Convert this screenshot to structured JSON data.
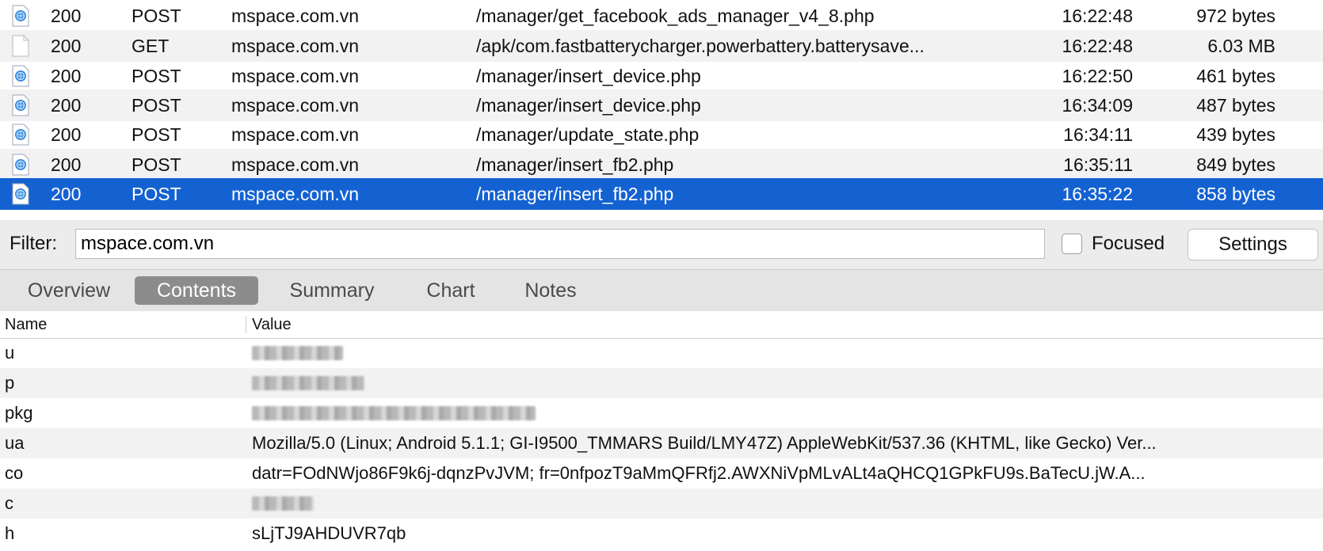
{
  "requests": [
    {
      "icon": "globe-doc-icon",
      "status": "200",
      "method": "POST",
      "host": "mspace.com.vn",
      "path": "/manager/get_facebook_ads_manager_v4_8.php",
      "time": "16:22:48",
      "size": "972 bytes"
    },
    {
      "icon": "blank-doc-icon",
      "status": "200",
      "method": "GET",
      "host": "mspace.com.vn",
      "path": "/apk/com.fastbatterycharger.powerbattery.batterysave...",
      "time": "16:22:48",
      "size": "6.03 MB"
    },
    {
      "icon": "globe-doc-icon",
      "status": "200",
      "method": "POST",
      "host": "mspace.com.vn",
      "path": "/manager/insert_device.php",
      "time": "16:22:50",
      "size": "461 bytes"
    },
    {
      "icon": "globe-doc-icon",
      "status": "200",
      "method": "POST",
      "host": "mspace.com.vn",
      "path": "/manager/insert_device.php",
      "time": "16:34:09",
      "size": "487 bytes"
    },
    {
      "icon": "globe-doc-icon",
      "status": "200",
      "method": "POST",
      "host": "mspace.com.vn",
      "path": "/manager/update_state.php",
      "time": "16:34:11",
      "size": "439 bytes"
    },
    {
      "icon": "globe-doc-icon",
      "status": "200",
      "method": "POST",
      "host": "mspace.com.vn",
      "path": "/manager/insert_fb2.php",
      "time": "16:35:11",
      "size": "849 bytes"
    },
    {
      "icon": "globe-doc-icon",
      "status": "200",
      "method": "POST",
      "host": "mspace.com.vn",
      "path": "/manager/insert_fb2.php",
      "time": "16:35:22",
      "size": "858 bytes",
      "selected": true
    }
  ],
  "filter": {
    "label": "Filter:",
    "value": "mspace.com.vn",
    "focused_label": "Focused",
    "focused_checked": false,
    "settings_label": "Settings"
  },
  "tabs": [
    "Overview",
    "Contents",
    "Summary",
    "Chart",
    "Notes"
  ],
  "active_tab": "Contents",
  "contents": {
    "headers": {
      "name": "Name",
      "value": "Value"
    },
    "params": [
      {
        "name": "u",
        "value": "",
        "redacted": true
      },
      {
        "name": "p",
        "value": "",
        "redacted": true
      },
      {
        "name": "pkg",
        "value": "",
        "redacted": true
      },
      {
        "name": "ua",
        "value": "Mozilla/5.0 (Linux; Android 5.1.1; GI-I9500_TMMARS Build/LMY47Z) AppleWebKit/537.36 (KHTML, like Gecko) Ver..."
      },
      {
        "name": "co",
        "value": "datr=FOdNWjo86F9k6j-dqnzPvJVM; fr=0nfpozT9aMmQFRfj2.AWXNiVpMLvALt4aQHCQ1GPkFU9s.BaTecU.jW.A..."
      },
      {
        "name": "c",
        "value": "",
        "redacted": true
      },
      {
        "name": "h",
        "value": "sLjTJ9AHDUVR7qb"
      }
    ]
  },
  "colors": {
    "selection": "#1462d2",
    "active_tab": "#8c8c8c",
    "row_alt": "#f2f2f2"
  }
}
